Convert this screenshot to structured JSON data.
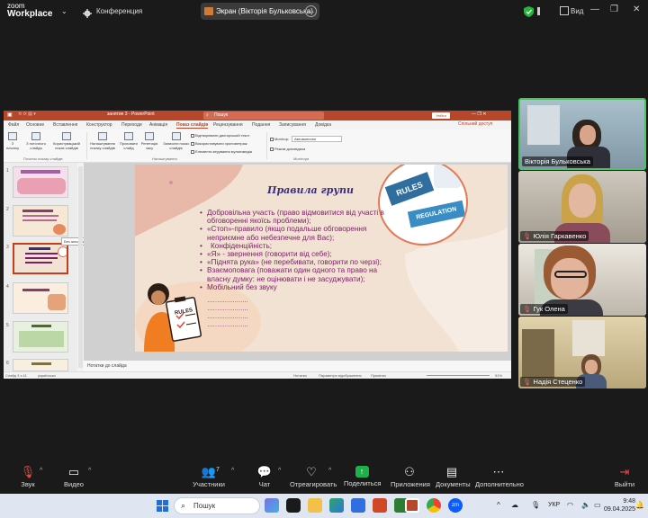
{
  "app": {
    "brand_top": "zoom",
    "brand_bottom": "Workplace"
  },
  "topbar": {
    "conference_label": "Конференция",
    "share_status": "Экран (Вікторія Бульковська)",
    "view_label": "Вид"
  },
  "ppt": {
    "file_name": "занятие 3  -  PowerPoint",
    "search_placeholder": "Пошук",
    "signin_label": "Увійти",
    "share_label": "Спільний доступ",
    "tabs": [
      "Файл",
      "Основне",
      "Вставлення",
      "Конструктор",
      "Переходи",
      "Анімація",
      "Показ слайдів",
      "Рецензування",
      "Подання",
      "Записування",
      "Довідка"
    ],
    "ribbon": {
      "from_start": "З початку",
      "from_current": "З поточного слайда",
      "custom_show": "Користувацький показ слайдів",
      "setup_show": "Налаштування показу слайдів",
      "hide_slide": "Приховати слайд",
      "rehearse": "Репетиція часу",
      "record": "Записати показ слайдів",
      "play_narrations": "Відтворювати дикторський текст",
      "use_timings": "Використовувати хронометраж",
      "show_media": "Елементи керування мультимедіа",
      "monitor_label": "Монітор:",
      "monitor_value": "Автоматично",
      "presenter_view": "Режим доповідача",
      "group_start": "Початок показу слайдів",
      "group_setup": "Налаштування",
      "group_monitors": "Монітори"
    },
    "thumb_tooltip": "Без заголовка",
    "thumb_numbers": [
      "1",
      "2",
      "3",
      "4",
      "5",
      "6"
    ],
    "slide": {
      "title": "Правила групи",
      "rules": [
        "Добровільна участь (право відмовитися від участі в обговоренні якоїсь проблеми);",
        "«Стоп»-правило (якщо подальше обговорення неприємне або небезпечне для Вас);",
        "Конфіденційність;",
        "«Я» - звернення (говорити від себе);",
        "«Піднята рука» (не перебивати, говорити по черзі);",
        "Взаємоповага (поважати один одного та право на власну думку: не оцінювати і не засуджувати);",
        "Мобільний без звуку"
      ],
      "dot_lines": [
        "…………………",
        "…………………",
        "…………………",
        "…………………"
      ],
      "puzzle_words": [
        "RULES",
        "REGULATION"
      ],
      "clipboard_word": "RULES"
    },
    "notes_label": "Нотатки до слайда",
    "status": {
      "slide_counter": "Слайд 3 з 41",
      "language": "українська",
      "notes_btn": "Нотатки",
      "display_settings": "Параметри відображення",
      "comments_btn": "Примітки",
      "zoom": "51%"
    }
  },
  "participants": [
    {
      "name": "Вікторія Бульковська",
      "muted": false,
      "active": true
    },
    {
      "name": "Юлія Гаркавенко",
      "muted": true,
      "active": false
    },
    {
      "name": "Гук Олена",
      "muted": true,
      "active": false
    },
    {
      "name": "Надія Стеценко",
      "muted": true,
      "active": false
    }
  ],
  "toolbar": {
    "audio": "Звук",
    "video": "Видео",
    "participants": "Участники",
    "participants_count": "7",
    "chat": "Чат",
    "react": "Отреагировать",
    "share": "Поделиться",
    "apps": "Приложения",
    "docs": "Документы",
    "more": "Дополнительно",
    "leave": "Выйти"
  },
  "taskbar": {
    "search_placeholder": "Пошук",
    "lang": "УКР",
    "time": "9:48",
    "date": "09.04.2025"
  },
  "colors": {
    "ppt_accent": "#b7472a",
    "slide_text": "#7b1e63",
    "slide_title": "#3a2d7a",
    "active_speaker": "#4bc35e",
    "share_green": "#1fb04b",
    "muted_red": "#ff5c5c"
  }
}
